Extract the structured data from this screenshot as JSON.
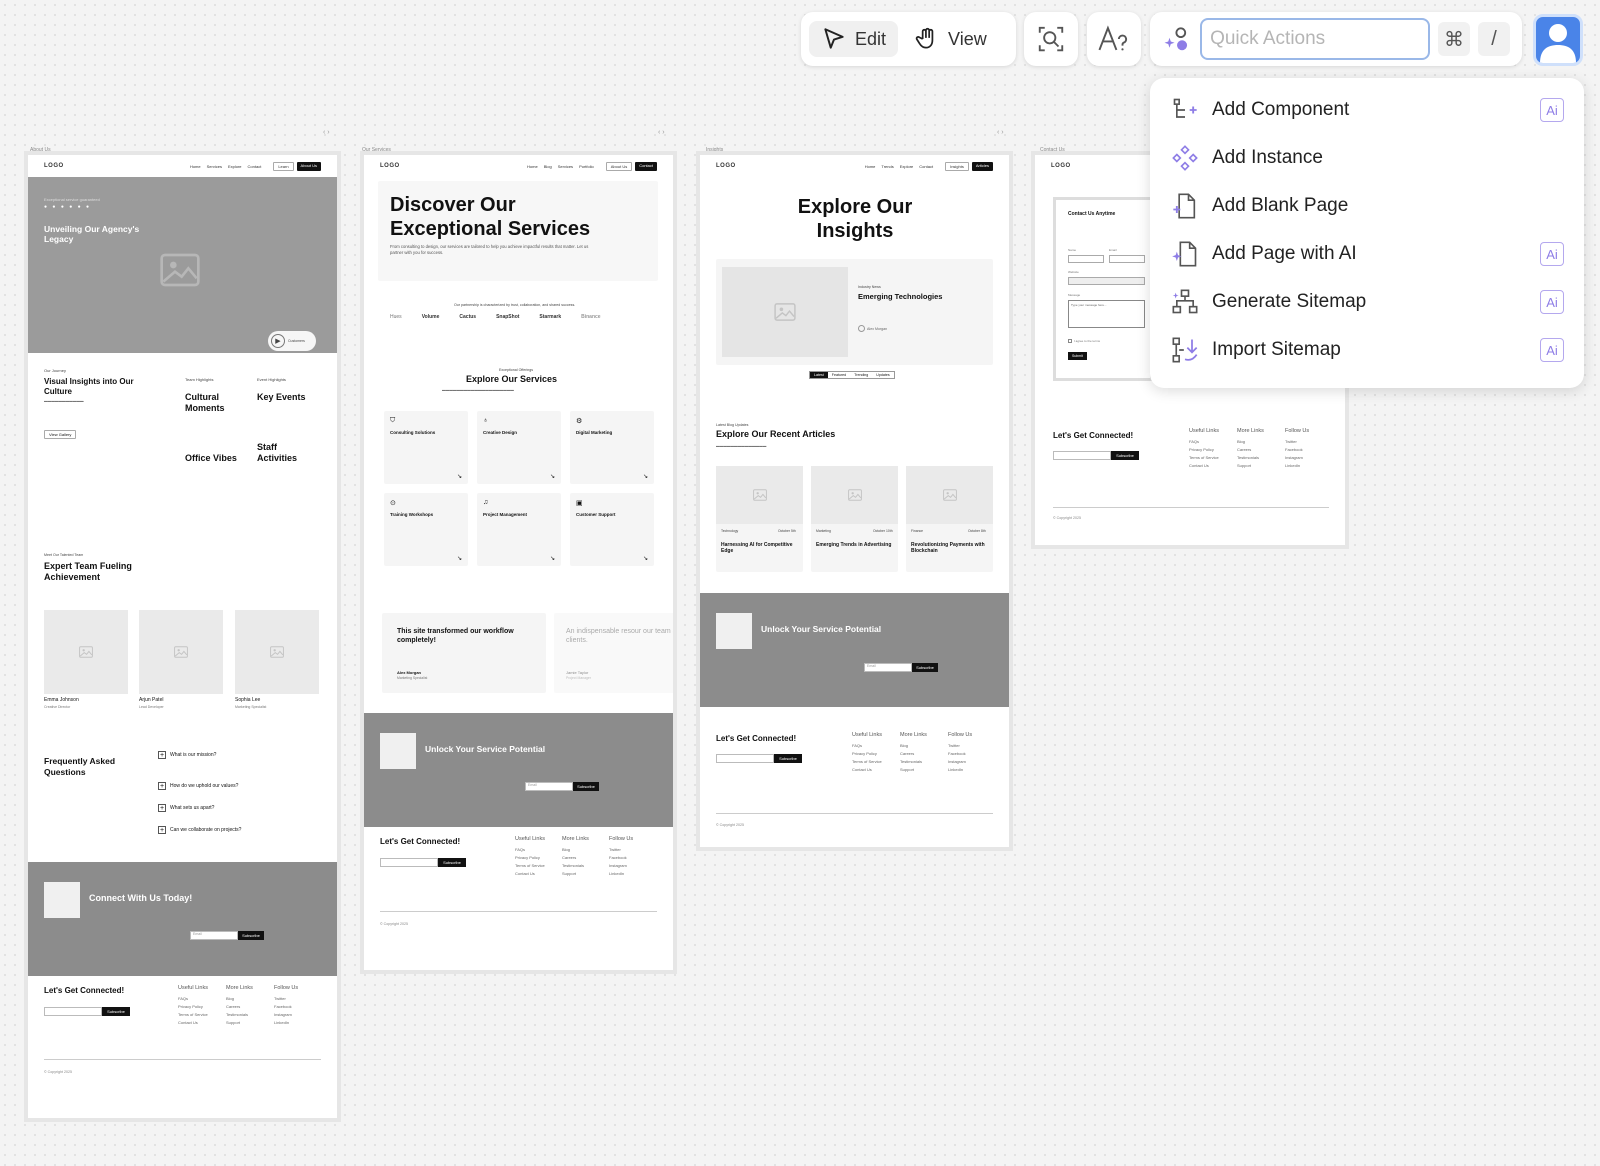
{
  "toolbar": {
    "edit_label": "Edit",
    "view_label": "View",
    "quick_actions_placeholder": "Quick Actions",
    "shortcut_cmd": "⌘",
    "shortcut_slash": "/"
  },
  "menu": {
    "items": [
      {
        "label": "Add Component",
        "icon": "add-component-icon",
        "ai": true
      },
      {
        "label": "Add Instance",
        "icon": "add-instance-icon",
        "ai": false
      },
      {
        "label": "Add Blank Page",
        "icon": "blank-page-icon",
        "ai": false
      },
      {
        "label": "Add Page with AI",
        "icon": "ai-page-icon",
        "ai": true
      },
      {
        "label": "Generate Sitemap",
        "icon": "sitemap-icon",
        "ai": true
      },
      {
        "label": "Import Sitemap",
        "icon": "import-sitemap-icon",
        "ai": true
      }
    ],
    "ai_badge": "Ai"
  },
  "frames": {
    "about": {
      "label": "About Us",
      "logo": "LOGO",
      "nav": [
        "Home",
        "Services",
        "Explore",
        "Contact"
      ],
      "nav_buttons": [
        "Learn",
        "About Us"
      ],
      "hero_kicker": "Exceptional service guaranteed",
      "hero_title": "Unveiling Our Agency's Legacy",
      "hero_badge": "Customers",
      "journey_kicker": "Our Journey",
      "journey_title": "Visual Insights into Our Culture",
      "view_gallery": "View Gallery",
      "team_highlights": "Team Highlights",
      "event_highlights": "Event Highlights",
      "cultural": "Cultural Moments",
      "key_events": "Key Events",
      "office": "Office Vibes",
      "staff": "Staff Activities",
      "team_kicker": "Meet Our Talented Team",
      "team_title": "Expert Team Fueling Achievement",
      "members": [
        {
          "name": "Emma Johnson",
          "role": "Creative Director"
        },
        {
          "name": "Arjun Patel",
          "role": "Lead Developer"
        },
        {
          "name": "Sophia Lee",
          "role": "Marketing Specialist"
        }
      ],
      "faq_title": "Frequently Asked Questions",
      "faqs": [
        "What is our mission?",
        "How do we uphold our values?",
        "What sets us apart?",
        "Can we collaborate on projects?"
      ],
      "cta_title": "Connect With Us Today!",
      "cta_email": "Email",
      "cta_button": "Subscribe",
      "footer_title": "Let's Get Connected!",
      "footer_subscribe": "Subscribe",
      "copyright": "© Copyright 2025"
    },
    "services": {
      "label": "Our Services",
      "logo": "LOGO",
      "nav": [
        "Home",
        "Blog",
        "Services",
        "Portfolio"
      ],
      "nav_buttons": [
        "About Us",
        "Contact"
      ],
      "hero_title": "Discover Our Exceptional Services",
      "hero_sub": "From consulting to design, our services are tailored to help you achieve impactful results that matter. Let us partner with you for success.",
      "partners_heading": "Our partnership is characterized by trust, collaboration, and shared success.",
      "partners": [
        "Hues",
        "Volume",
        "Cactus",
        "SnapShot",
        "Starmark",
        "Binance"
      ],
      "offer_kicker": "Exceptional Offerings",
      "offer_title": "Explore Our  Services",
      "services": [
        "Consulting Solutions",
        "Creative Design",
        "Digital Marketing",
        "Training Workshops",
        "Project Management",
        "Customer Support"
      ],
      "testimonial_1": "This site transformed our workflow completely!",
      "testimonial_1_name": "Alex Morgan",
      "testimonial_1_role": "Marketing Specialist",
      "testimonial_2": "An indispensable resour our team and clients.",
      "testimonial_2_name": "Jamie Taylor",
      "testimonial_2_role": "Project Manager",
      "cta_title": "Unlock Your Service Potential",
      "cta_email": "Email",
      "cta_button": "Subscribe",
      "footer_title": "Let's Get Connected!",
      "footer_subscribe": "Subscribe",
      "copyright": "© Copyright 2025"
    },
    "insights": {
      "label": "Insights",
      "logo": "LOGO",
      "nav": [
        "Home",
        "Trends",
        "Explore",
        "Contact"
      ],
      "nav_buttons": [
        "Insights",
        "Articles"
      ],
      "hero_title": "Explore Our Insights",
      "feature_kicker": "Industry News",
      "feature_title": "Emerging Technologies",
      "feature_author": "Alex Morgan",
      "tabs": [
        "Latest",
        "Featured",
        "Trending",
        "Updates"
      ],
      "articles_kicker": "Latest Blog Updates",
      "articles_title": "Explore Our Recent Articles",
      "articles": [
        {
          "tag": "Technology",
          "date": "October 5th",
          "title": "Harnessing AI for Competitive Edge"
        },
        {
          "tag": "Marketing",
          "date": "October 10th",
          "title": "Emerging Trends in Advertising"
        },
        {
          "tag": "Finance",
          "date": "October 8th",
          "title": "Revolutionizing Payments with Blockchain"
        }
      ],
      "cta_title": "Unlock Your Service Potential",
      "cta_email": "Email",
      "cta_button": "Subscribe",
      "footer_title": "Let's Get Connected!",
      "footer_subscribe": "Subscribe",
      "copyright": "© Copyright 2025"
    },
    "contact": {
      "label": "Contact Us",
      "logo": "LOGO",
      "nav": [
        "Home"
      ],
      "form_title": "Contact Us Anytime",
      "form_name": "Name",
      "form_email": "Email",
      "form_website": "Website",
      "form_message": "Message",
      "form_message_placeholder": "Type your message here...",
      "form_agree": "I agree to the terms",
      "form_submit": "Submit",
      "footer_title": "Let's Get Connected!",
      "footer_subscribe": "Subscribe",
      "copyright": "© Copyright 2025"
    }
  },
  "footer_columns": {
    "useful": {
      "title": "Useful Links",
      "items": [
        "FAQs",
        "Privacy Policy",
        "Terms of Service",
        "Contact Us"
      ]
    },
    "more": {
      "title": "More Links",
      "items": [
        "Blog",
        "Careers",
        "Testimonials",
        "Support"
      ]
    },
    "follow": {
      "title": "Follow Us",
      "items": [
        "Twitter",
        "Facebook",
        "Instagram",
        "LinkedIn"
      ]
    }
  }
}
